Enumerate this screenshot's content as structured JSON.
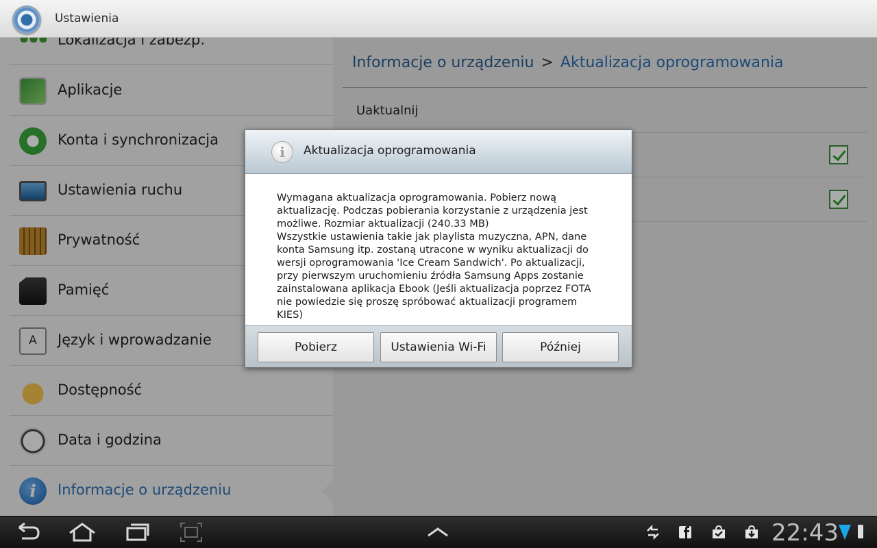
{
  "app": {
    "title": "Ustawienia"
  },
  "sidebar": {
    "items": [
      {
        "label": "Lokalizacja i zabezp.",
        "icon": "lock-icon"
      },
      {
        "label": "Aplikacje",
        "icon": "applications-icon"
      },
      {
        "label": "Konta i synchronizacja",
        "icon": "sync-icon"
      },
      {
        "label": "Ustawienia ruchu",
        "icon": "motion-icon"
      },
      {
        "label": "Prywatność",
        "icon": "privacy-icon"
      },
      {
        "label": "Pamięć",
        "icon": "storage-icon"
      },
      {
        "label": "Język i wprowadzanie",
        "icon": "language-icon"
      },
      {
        "label": "Dostępność",
        "icon": "accessibility-icon"
      },
      {
        "label": "Data i godzina",
        "icon": "clock-icon"
      },
      {
        "label": "Informacje o urządzeniu",
        "icon": "info-icon",
        "selected": true
      }
    ],
    "lang_icon_glyph": "A"
  },
  "main": {
    "breadcrumb": {
      "parent": "Informacje o urządzeniu",
      "separator": ">",
      "current": "Aktualizacja oprogramowania"
    },
    "rows": [
      {
        "label": "Uaktualnij"
      },
      {
        "label": "",
        "checked": true
      },
      {
        "label": "",
        "checked": true
      }
    ]
  },
  "dialog": {
    "title": "Aktualizacja oprogramowania",
    "icon_glyph": "i",
    "message": "Wymagana aktualizacja oprogramowania. Pobierz nową aktualizację. Podczas pobierania korzystanie z urządzenia jest możliwe. Rozmiar aktualizacji (240.33 MB)\nWszystkie ustawienia takie jak playlista muzyczna, APN, dane konta Samsung itp. zostaną utracone w wyniku aktualizacji do wersji oprogramowania 'Ice Cream Sandwich'. Po aktualizacji, przy pierwszym uruchomieniu źródła Samsung Apps zostanie zainstalowana aplikacja Ebook (Jeśli aktualizacja poprzez FOTA nie powiedzie się proszę spróbować aktualizacji programem KIES)",
    "buttons": {
      "download": "Pobierz",
      "wifi_settings": "Ustawienia Wi-Fi",
      "later": "Później"
    }
  },
  "statusbar": {
    "time": "22:43",
    "signal_color": "#1aa7e6"
  },
  "colors": {
    "accent": "#2a6db0",
    "check": "#2f9a2f"
  }
}
